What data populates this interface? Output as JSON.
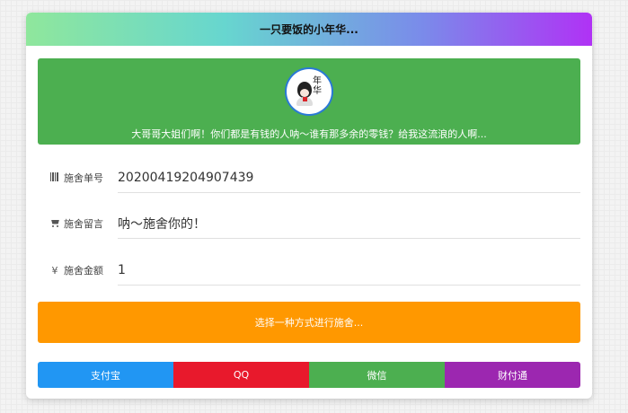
{
  "header": {
    "title": "一只要饭的小年华..."
  },
  "banner": {
    "avatar_text": "年华",
    "message": "大哥哥大姐们啊！你们都是有钱的人呐～谁有那多余的零钱？给我这流浪的人啊..."
  },
  "fields": {
    "order": {
      "label": "施舍单号",
      "value": "20200419204907439",
      "icon": "barcode-icon"
    },
    "message": {
      "label": "施舍留言",
      "value": "呐～施舍你的！",
      "icon": "cart-icon"
    },
    "amount": {
      "label": "施舍金额",
      "value": "1",
      "icon": "yen-icon",
      "icon_glyph": "¥"
    }
  },
  "prompt": "选择一种方式进行施舍...",
  "payments": [
    {
      "label": "支付宝",
      "color": "#2196f3"
    },
    {
      "label": "QQ",
      "color": "#e8192c"
    },
    {
      "label": "微信",
      "color": "#4caf50"
    },
    {
      "label": "财付通",
      "color": "#9c27b0"
    }
  ],
  "colors": {
    "banner": "#4caf50",
    "prompt": "#ff9800"
  }
}
